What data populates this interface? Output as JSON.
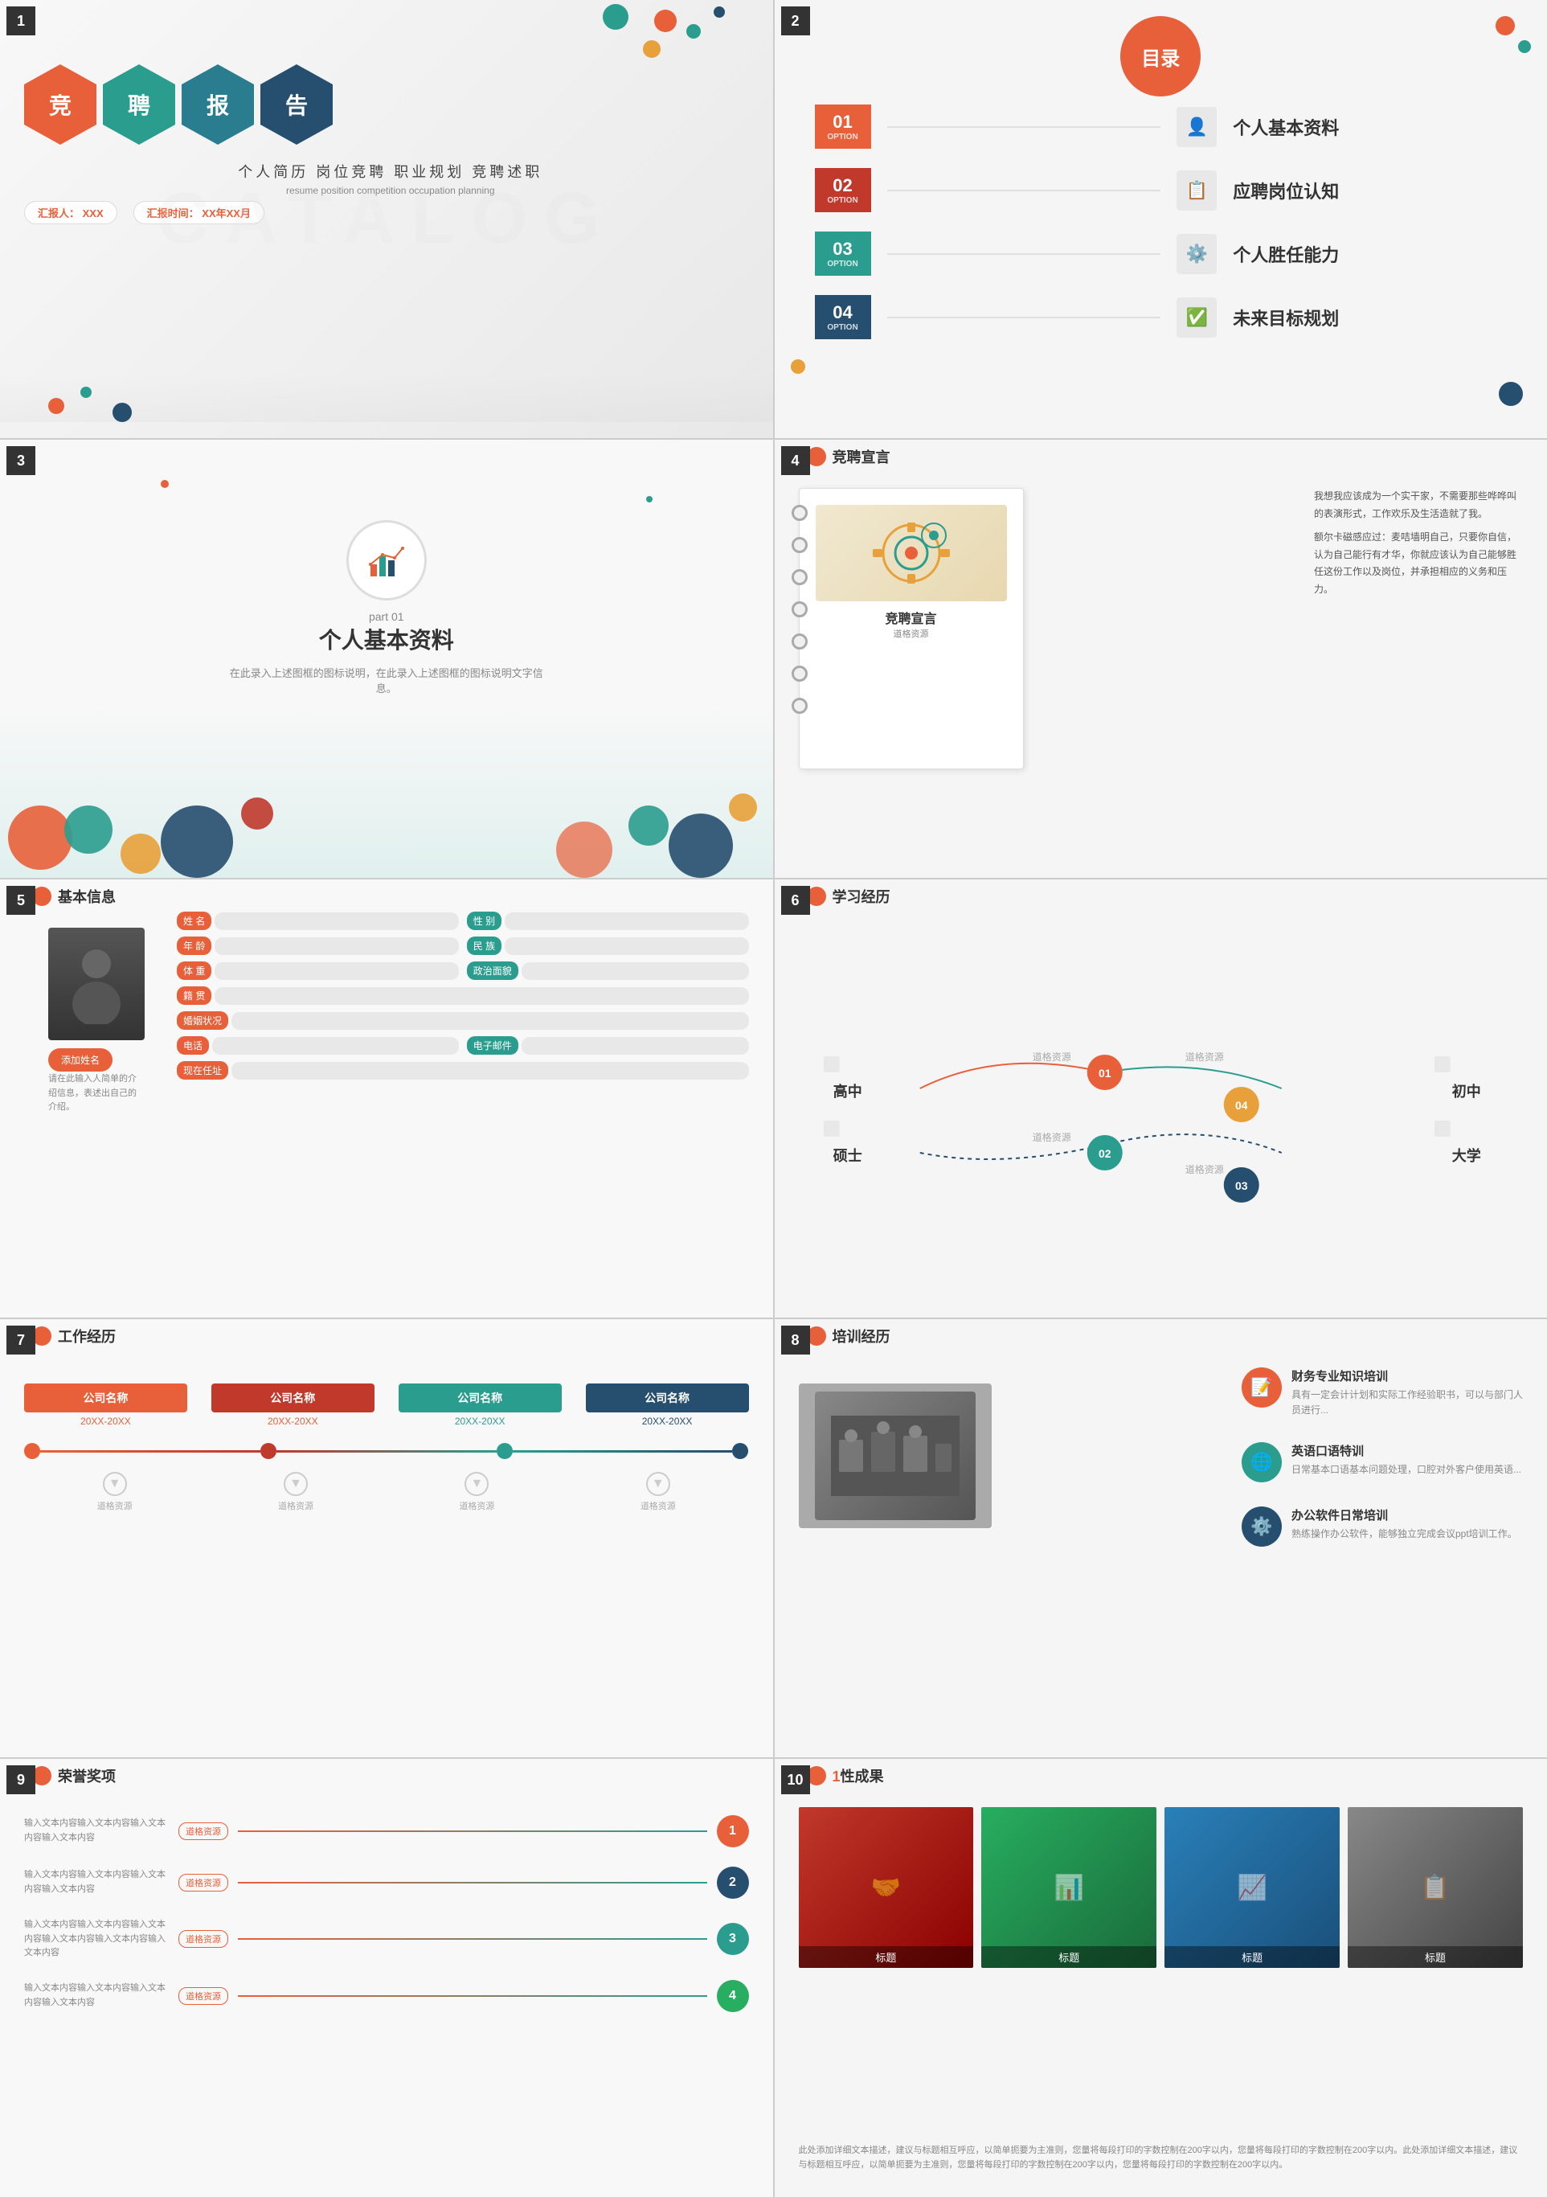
{
  "cells": [
    {
      "id": 1,
      "label": "1",
      "title": "竞聘报告",
      "hex_chars": [
        "竞",
        "聘",
        "报",
        "告"
      ],
      "subtitle_cn": "个人简历 岗位竞聘 职业规划 竞聘述职",
      "subtitle_en": "resume  position competition  occupation planning",
      "reporter_label": "汇报人：",
      "reporter_value": "XXX",
      "date_label": "汇报时间：",
      "date_value": "XX年XX月"
    },
    {
      "id": 2,
      "label": "2",
      "header": "目录",
      "items": [
        {
          "num": "01",
          "opt": "OPTION",
          "label": "个人基本资料",
          "icon": "👤"
        },
        {
          "num": "02",
          "opt": "OPTION",
          "label": "应聘岗位认知",
          "icon": "📋"
        },
        {
          "num": "03",
          "opt": "OPTION",
          "label": "个人胜任能力",
          "icon": "⚙️"
        },
        {
          "num": "04",
          "opt": "OPTION",
          "label": "未来目标规划",
          "icon": "✅"
        }
      ]
    },
    {
      "id": 3,
      "label": "3",
      "part_label": "part 01",
      "part_title": "个人基本资料",
      "part_desc": "在此录入上述图框的图标说明，在此录入上述图框的图标说明文字信息。"
    },
    {
      "id": 4,
      "label": "4",
      "header": "竞聘宣言",
      "notebook_title": "竞聘宣言",
      "notebook_subtitle": "道格资源",
      "text1": "我想我应该成为一个实干家，不需要那些哗哗叫的表演形式，工作欢乐及生活造就了我。",
      "text2": "额尔卡磁感应过：麦咭墙明自己，只要你自信，认为自己能行有才华，你就应该认为自己能够胜任这份工作以及岗位，并承担相应的义务和压力。"
    },
    {
      "id": 5,
      "label": "5",
      "header": "基本信息",
      "fields_left": [
        {
          "label": "姓  名"
        },
        {
          "label": "年  龄"
        },
        {
          "label": "体  重"
        },
        {
          "label": "籍  贯"
        },
        {
          "label": "婚姻状况"
        }
      ],
      "fields_right": [
        {
          "label": "性  别"
        },
        {
          "label": "民  族"
        },
        {
          "label": "政治面貌"
        }
      ],
      "fields_bottom": [
        {
          "label": "电话"
        },
        {
          "label": "电子邮件"
        },
        {
          "label": "现在任址"
        }
      ],
      "add_name": "添加姓名",
      "desc": "请在此输入人简单的介绍信息，表述出自己的介绍。"
    },
    {
      "id": 6,
      "label": "6",
      "header": "学习经历",
      "items": [
        {
          "school": "高中",
          "num": "01",
          "text": "道格资源"
        },
        {
          "school": "大学",
          "num": "02",
          "text": "道格资源"
        },
        {
          "school": "硕士",
          "num": "03",
          "text": "道格资源"
        },
        {
          "num": "04",
          "text": "道格资源"
        }
      ]
    },
    {
      "id": 7,
      "label": "7",
      "header": "工作经历",
      "companies": [
        {
          "name": "公司名称",
          "date": "20XX-20XX",
          "color": "cn1"
        },
        {
          "name": "公司名称",
          "date": "20XX-20XX",
          "color": "cn2"
        },
        {
          "name": "公司名称",
          "date": "20XX-20XX",
          "color": "cn3"
        },
        {
          "name": "公司名称",
          "date": "20XX-20XX",
          "color": "cn4"
        }
      ],
      "desc": "道格资源"
    },
    {
      "id": 8,
      "label": "8",
      "header": "培训经历",
      "trainings": [
        {
          "title": "财务专业知识培训",
          "desc": "具有一定会计计划和实际工作经验职书，可以与部门人员进行...",
          "icon": "📝",
          "color": "ti-orange"
        },
        {
          "title": "英语口语特训",
          "desc": "日常基本口语基本问题处理，口腔对外客户使用英语...",
          "icon": "🌐",
          "color": "ti-teal"
        },
        {
          "title": "办公软件日常培训",
          "desc": "熟练操作办公软件，能够独立完成会议ppt培训工作。",
          "icon": "⚙️",
          "color": "ti-dark"
        }
      ]
    },
    {
      "id": 9,
      "label": "9",
      "header": "荣誉奖项",
      "awards": [
        {
          "text": "输入文本内容输入文本内容输入文本内容输入文本内容",
          "badge": "道格资源",
          "num": "1",
          "color": "anc-orange"
        },
        {
          "text": "输入文本内容输入文本内容输入文本内容输入文本内容",
          "badge": "道格资源",
          "num": "2",
          "color": "anc-dark"
        },
        {
          "text": "输入文本内容输入文本内容输入文本内容输入文本内容输入文本内容输入文本内容",
          "badge": "道格资源",
          "num": "3",
          "color": "anc-teal"
        },
        {
          "text": "输入文本内容输入文本内容输入文本内容输入文本内容",
          "badge": "道格资源",
          "num": "4",
          "color": "anc-green"
        }
      ]
    },
    {
      "id": 10,
      "label": "10",
      "header": "性成果",
      "photos": [
        {
          "title": "标题"
        },
        {
          "title": "标题"
        },
        {
          "title": "标题"
        },
        {
          "title": "标题"
        }
      ],
      "desc": "此处添加详细文本描述，建议与标题相互呼应，以简单扼要为主准则，您量将每段打印的字数控制在200字以内，您量将每段打印的字数控制在200字以内。此处添加详细文本描述，建议与标题相互呼应，以简单扼要为主准则，您量将每段打印的字数控制在200字以内，您量将每段打印的字数控制在200字以内。"
    }
  ],
  "watermark": "CATALOG",
  "colors": {
    "orange": "#e8603a",
    "teal": "#2a9d8f",
    "dark": "#264e6e",
    "red": "#c0392b"
  }
}
